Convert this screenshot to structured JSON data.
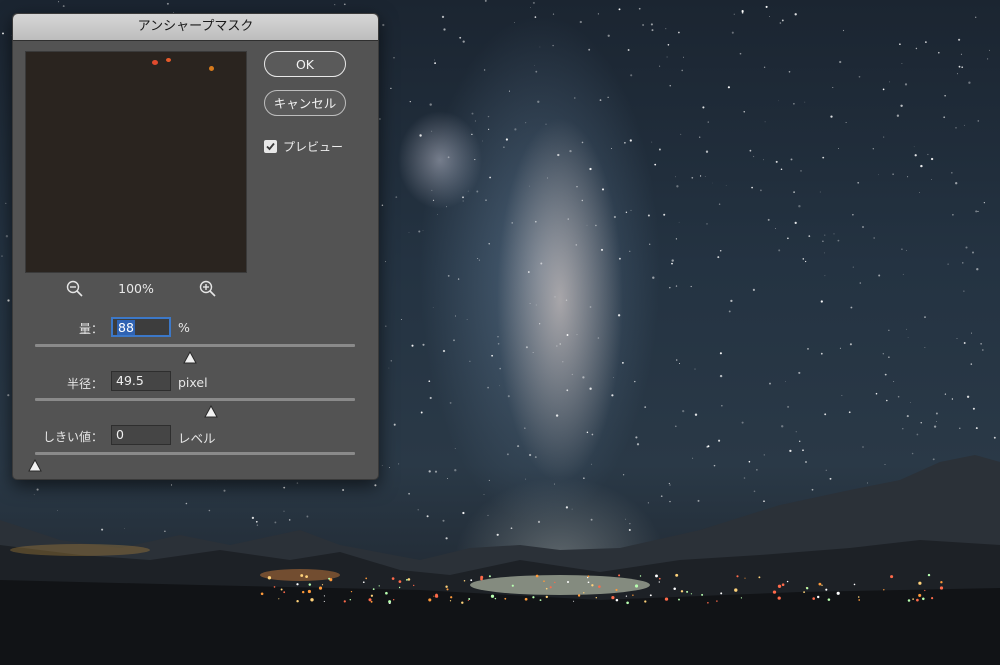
{
  "dialog": {
    "title": "アンシャープマスク",
    "ok_label": "OK",
    "cancel_label": "キャンセル",
    "preview_label": "プレビュー",
    "preview_checked": true,
    "zoom_level": "100%",
    "fields": [
      {
        "label": "量：",
        "value": "88",
        "unit": "%",
        "slider_fraction": 0.485
      },
      {
        "label": "半径：",
        "value": "49.5",
        "unit": "pixel",
        "slider_fraction": 0.55
      },
      {
        "label": "しきい値：",
        "value": "0",
        "unit": "レベル",
        "slider_fraction": 0.0
      }
    ]
  },
  "icons": {
    "zoom_out": "zoom-out-icon",
    "zoom_in": "zoom-in-icon",
    "checkbox": "checkmark-icon",
    "slider_thumb": "triangle-thumb-icon"
  },
  "colors": {
    "dialog_bg": "#535353",
    "titlebar_bg": "#c8c8c8",
    "focus_border": "#3c78c8",
    "selection": "#2f63b3"
  }
}
